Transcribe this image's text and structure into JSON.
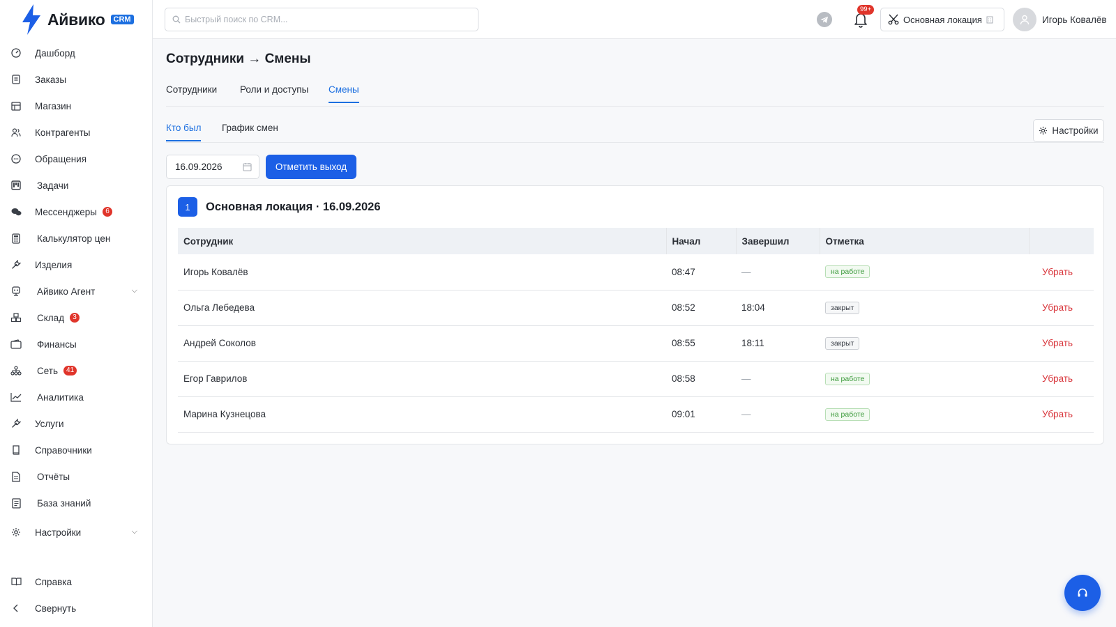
{
  "brand": {
    "name": "Айвико",
    "badge": "CRM"
  },
  "sidebar": {
    "items": [
      {
        "label": "Дашборд",
        "icon": "dashboard-icon"
      },
      {
        "label": "Заказы",
        "icon": "orders-icon"
      },
      {
        "label": "Магазин",
        "icon": "store-icon"
      },
      {
        "label": "Контрагенты",
        "icon": "contacts-icon"
      },
      {
        "label": "Обращения",
        "icon": "chat-icon"
      },
      {
        "label": "Задачи",
        "icon": "kanban-icon"
      },
      {
        "label": "Мессенджеры",
        "icon": "messenger-icon",
        "badge": "6"
      },
      {
        "label": "Калькулятор цен",
        "icon": "calculator-icon"
      },
      {
        "label": "Изделия",
        "icon": "wrench-icon"
      },
      {
        "label": "Айвико Агент",
        "icon": "agent-icon",
        "expandable": true
      },
      {
        "label": "Склад",
        "icon": "warehouse-icon",
        "badge": "3"
      },
      {
        "label": "Финансы",
        "icon": "wallet-icon"
      },
      {
        "label": "Сеть",
        "icon": "network-icon",
        "badge": "41"
      },
      {
        "label": "Аналитика",
        "icon": "chart-icon"
      },
      {
        "label": "Услуги",
        "icon": "tool-icon"
      },
      {
        "label": "Справочники",
        "icon": "book-icon"
      },
      {
        "label": "Отчёты",
        "icon": "report-icon"
      },
      {
        "label": "База знаний",
        "icon": "knowledge-icon"
      },
      {
        "label": "Настройки",
        "icon": "gear-icon",
        "expandable": true
      }
    ],
    "bottom": [
      {
        "label": "Справка",
        "icon": "help-book-icon"
      },
      {
        "label": "Свернуть",
        "icon": "chevron-left-icon"
      }
    ]
  },
  "header": {
    "search_placeholder": "Быстрый поиск по CRM...",
    "notifications_badge": "99+",
    "location": "Основная локация",
    "user_name": "Игорь Ковалёв"
  },
  "page": {
    "title": "Сотрудники → Смены",
    "tabs": [
      "Сотрудники",
      "Роли и доступы",
      "Смены"
    ],
    "active_tab": "Смены",
    "subtabs": [
      "Кто был",
      "График смен"
    ],
    "active_subtab": "Кто был",
    "settings_label": "Настройки",
    "date_value": "16.09.2026",
    "mark_button": "Отметить выход"
  },
  "card": {
    "number": "1",
    "title": "Основная локация · 16.09.2026",
    "columns": [
      "Сотрудник",
      "Начал",
      "Завершил",
      "Отметка",
      ""
    ],
    "rows": [
      {
        "name": "Игорь Ковалёв",
        "start": "08:47",
        "end": "—",
        "status": "на работе",
        "state": "on",
        "action": "Убрать"
      },
      {
        "name": "Ольга Лебедева",
        "start": "08:52",
        "end": "18:04",
        "status": "закрыт",
        "state": "off",
        "action": "Убрать"
      },
      {
        "name": "Андрей Соколов",
        "start": "08:55",
        "end": "18:11",
        "status": "закрыт",
        "state": "off",
        "action": "Убрать"
      },
      {
        "name": "Егор Гаврилов",
        "start": "08:58",
        "end": "—",
        "status": "на работе",
        "state": "on",
        "action": "Убрать"
      },
      {
        "name": "Марина Кузнецова",
        "start": "09:01",
        "end": "—",
        "status": "на работе",
        "state": "on",
        "action": "Убрать"
      }
    ]
  },
  "colors": {
    "accent": "#1c5fe6",
    "danger": "#d8343a",
    "success": "#3b9a3b"
  }
}
